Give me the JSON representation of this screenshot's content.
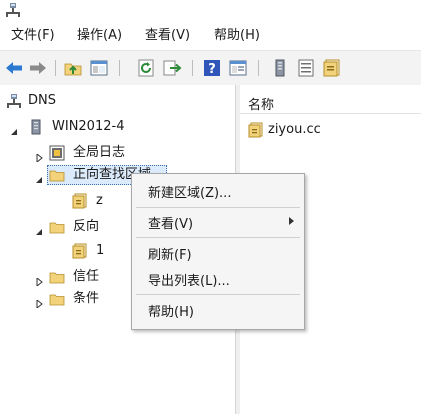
{
  "menubar": {
    "items": [
      "文件(F)",
      "操作(A)",
      "查看(V)",
      "帮助(H)"
    ]
  },
  "tree": {
    "root": "DNS",
    "server": "WIN2012-4",
    "global_logs": "全局日志",
    "forward_zones": "正向查找区域",
    "forward_child": "z",
    "reverse_zones": "反向",
    "reverse_child": "1",
    "trust": "信任",
    "conditional": "条件"
  },
  "list": {
    "column_name": "名称",
    "rows": [
      "ziyou.cc"
    ]
  },
  "context_menu": {
    "items": [
      "新建区域(Z)...",
      "查看(V)",
      "刷新(F)",
      "导出列表(L)...",
      "帮助(H)"
    ]
  },
  "colors": {
    "folder": "#f2d27a",
    "blue_arrow": "#2b79d1",
    "help_blue": "#2f56b8"
  },
  "icons": {
    "title": "dns-console-icon",
    "back": "back-arrow-icon",
    "forward": "forward-arrow-icon",
    "up_folder": "up-folder-icon",
    "show_tree": "show-hide-tree-icon",
    "refresh": "refresh-icon",
    "export": "export-list-icon",
    "help": "help-icon",
    "properties": "properties-icon",
    "server": "server-icon",
    "list_view": "list-view-icon",
    "zone": "zone-icon"
  }
}
